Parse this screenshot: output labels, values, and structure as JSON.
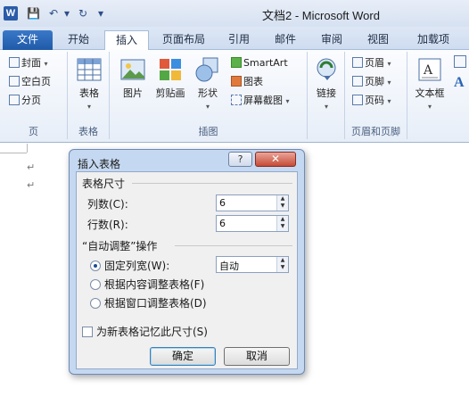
{
  "window": {
    "title": "文档2 - Microsoft Word"
  },
  "qat": {
    "save": "💾",
    "undo": "↶",
    "redo": "↻",
    "customize": "▾"
  },
  "tabs": [
    "文件",
    "开始",
    "插入",
    "页面布局",
    "引用",
    "邮件",
    "审阅",
    "视图",
    "加载项"
  ],
  "ribbon": {
    "pages_group": {
      "label": "页",
      "cover": "封面",
      "blank": "空白页",
      "break": "分页"
    },
    "table_group": {
      "label": "表格",
      "table": "表格"
    },
    "illustrations_group": {
      "label": "插图",
      "picture": "图片",
      "clipart": "剪贴画",
      "shapes": "形状",
      "smartart": "SmartArt",
      "chart": "图表",
      "screenshot": "屏幕截图"
    },
    "links_group": {
      "label": "",
      "links": "链接"
    },
    "header_footer_group": {
      "label": "页眉和页脚",
      "header": "页眉",
      "footer": "页脚",
      "page_number": "页码"
    },
    "text_group": {
      "textbox": "文本框"
    }
  },
  "dialog": {
    "title": "插入表格",
    "help": "?",
    "close": "✕",
    "size_section": "表格尺寸",
    "columns_label": "列数(C):",
    "columns_value": "6",
    "rows_label": "行数(R):",
    "rows_value": "6",
    "autofit_section": "“自动调整”操作",
    "fixed_width": "固定列宽(W):",
    "fixed_width_value": "自动",
    "autofit_content": "根据内容调整表格(F)",
    "autofit_window": "根据窗口调整表格(D)",
    "remember": "为新表格记忆此尺寸(S)",
    "ok": "确定",
    "cancel": "取消"
  },
  "document": {
    "paragraph_mark": "↵"
  },
  "colors": {
    "file_tab": "#2a64b4",
    "close_button": "#c64a36",
    "dialog_frame": "#c5d8f1"
  }
}
